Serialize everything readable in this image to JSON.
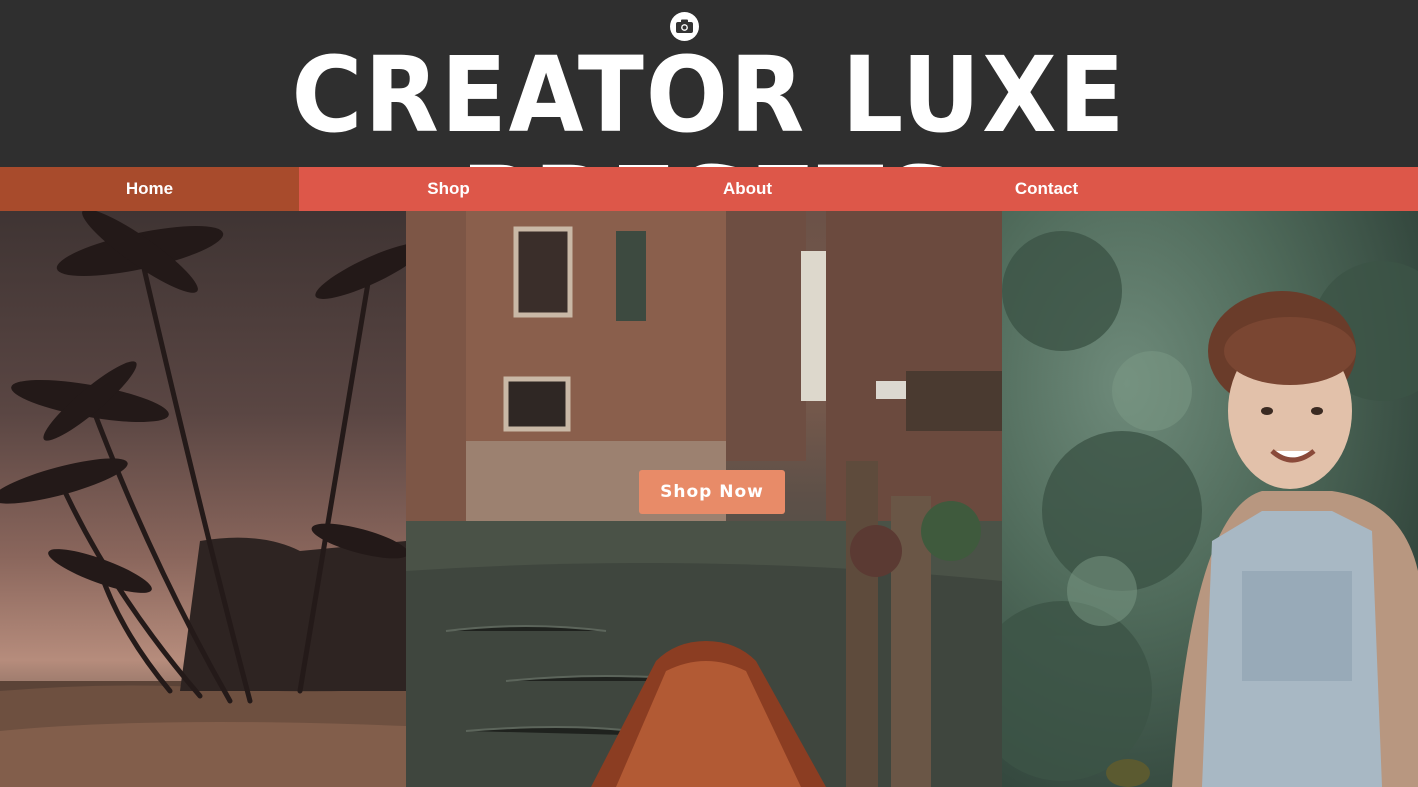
{
  "brand": {
    "title": "CREATOR LUXE PRESETS",
    "logo_icon": "camera-icon"
  },
  "nav": {
    "items": [
      {
        "label": "Home",
        "active": true
      },
      {
        "label": "Shop",
        "active": false
      },
      {
        "label": "About",
        "active": false
      },
      {
        "label": "Contact",
        "active": false
      }
    ]
  },
  "hero": {
    "cta_label": "Shop Now"
  },
  "colors": {
    "header_bg": "#2f2f2f",
    "nav_bg": "#dd5749",
    "nav_active_bg": "#a84b2c",
    "cta_bg": "#e88b68",
    "text": "#ffffff"
  }
}
